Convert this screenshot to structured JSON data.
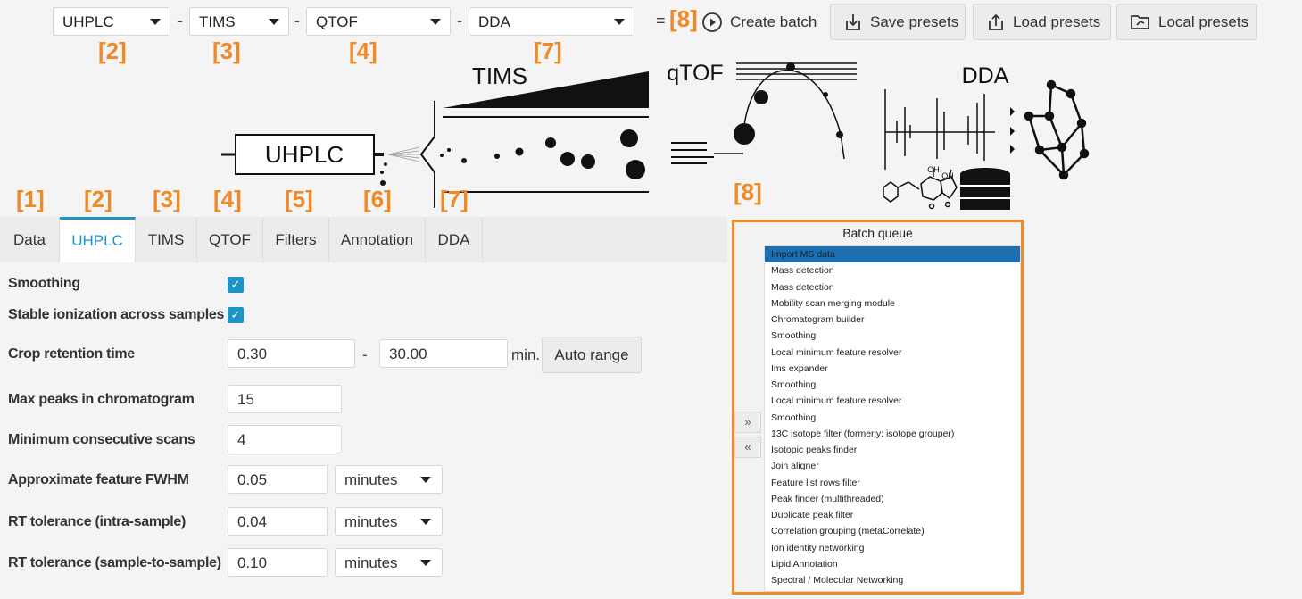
{
  "toolbar": {
    "combos": [
      "UHPLC",
      "TIMS",
      "QTOF",
      "DDA"
    ],
    "dash": "-",
    "equals": "=",
    "buttons": [
      "Create batch",
      "Save presets",
      "Load presets",
      "Local presets"
    ]
  },
  "markers": {
    "m2": "[2]",
    "m3": "[3]",
    "m4": "[4]",
    "m7": "[7]",
    "m8top": "[8]",
    "m8": "[8]",
    "tab1": "[1]",
    "tab2": "[2]",
    "tab3": "[3]",
    "tab4": "[4]",
    "tab5": "[5]",
    "tab6": "[6]",
    "tab7": "[7]"
  },
  "illustration": {
    "uhplc": "UHPLC",
    "tims": "TIMS",
    "qtof": "qTOF",
    "dda": "DDA",
    "oh1": "OH",
    "oh2": "OH"
  },
  "tabs": [
    "Data",
    "UHPLC",
    "TIMS",
    "QTOF",
    "Filters",
    "Annotation",
    "DDA"
  ],
  "active_tab": "UHPLC",
  "form": {
    "smoothing": {
      "label": "Smoothing",
      "checked": true
    },
    "stable": {
      "label": "Stable ionization across samples",
      "checked": true
    },
    "crop": {
      "label": "Crop retention time",
      "from": "0.30",
      "sep": "-",
      "to": "30.00",
      "unit": "min.",
      "button": "Auto range"
    },
    "max_peaks": {
      "label": "Max peaks in chromatogram",
      "value": "15"
    },
    "min_scans": {
      "label": "Minimum consecutive scans",
      "value": "4"
    },
    "fwhm": {
      "label": "Approximate feature FWHM",
      "value": "0.05",
      "unit": "minutes"
    },
    "rt_intra": {
      "label": "RT tolerance (intra-sample)",
      "value": "0.04",
      "unit": "minutes"
    },
    "rt_sample": {
      "label": "RT tolerance (sample-to-sample)",
      "value": "0.10",
      "unit": "minutes"
    }
  },
  "batch_queue": {
    "title": "Batch queue",
    "add": "»",
    "remove": "«",
    "items": [
      "Import MS data",
      "Mass detection",
      "Mass detection",
      "Mobility scan merging module",
      "Chromatogram builder",
      "Smoothing",
      "Local minimum feature resolver",
      "Ims expander",
      "Smoothing",
      "Local minimum feature resolver",
      "Smoothing",
      "13C isotope filter (formerly: isotope grouper)",
      "Isotopic peaks finder",
      "Join aligner",
      "Feature list rows filter",
      "Peak finder (multithreaded)",
      "Duplicate peak filter",
      "Correlation grouping (metaCorrelate)",
      "Ion identity networking",
      "Lipid Annotation",
      "Spectral / Molecular Networking"
    ],
    "selected_index": 0
  },
  "colors": {
    "accent": "#1e93c7",
    "marker": "#ef8a26",
    "selection": "#1e6fb0"
  }
}
